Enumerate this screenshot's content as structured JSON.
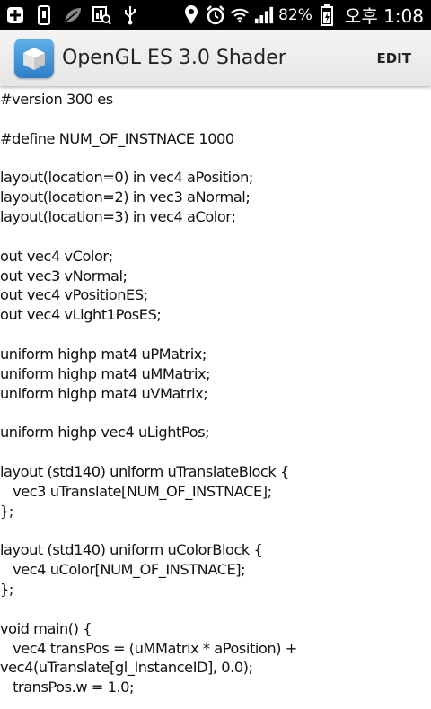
{
  "status_bar": {
    "battery_percent": "82%",
    "clock": "오후 1:08",
    "icons": [
      "plus-icon",
      "usb-debug-icon",
      "leaf-icon",
      "screenshot-icon",
      "usb-icon",
      "location-icon",
      "alarm-icon",
      "wifi-icon",
      "signal-icon",
      "battery-charging-icon"
    ]
  },
  "action_bar": {
    "title": "OpenGL ES 3.0 Shader",
    "edit_label": "EDIT",
    "app_icon": "cube-icon"
  },
  "code": {
    "lines": [
      "#version 300 es",
      "",
      "#define NUM_OF_INSTNACE 1000",
      "",
      "layout(location=0) in vec4 aPosition;",
      "layout(location=2) in vec3 aNormal;",
      "layout(location=3) in vec4 aColor;",
      "",
      "out vec4 vColor;",
      "out vec3 vNormal;",
      "out vec4 vPositionES;",
      "out vec4 vLight1PosES;",
      "",
      "uniform highp mat4 uPMatrix;",
      "uniform highp mat4 uMMatrix;",
      "uniform highp mat4 uVMatrix;",
      "",
      "uniform highp vec4 uLightPos;",
      "",
      "layout (std140) uniform uTranslateBlock {",
      "   vec3 uTranslate[NUM_OF_INSTNACE];",
      "};",
      "",
      "layout (std140) uniform uColorBlock {",
      "   vec4 uColor[NUM_OF_INSTNACE];",
      "};",
      "",
      "void main() {",
      "   vec4 transPos = (uMMatrix * aPosition) +",
      "vec4(uTranslate[gl_InstanceID], 0.0);",
      "   transPos.w = 1.0;"
    ]
  },
  "colors": {
    "status_bar_bg": "#000000",
    "action_bar_bg": "#eeeeee",
    "app_icon_blue": "#3d8fd6",
    "text": "#111111"
  }
}
